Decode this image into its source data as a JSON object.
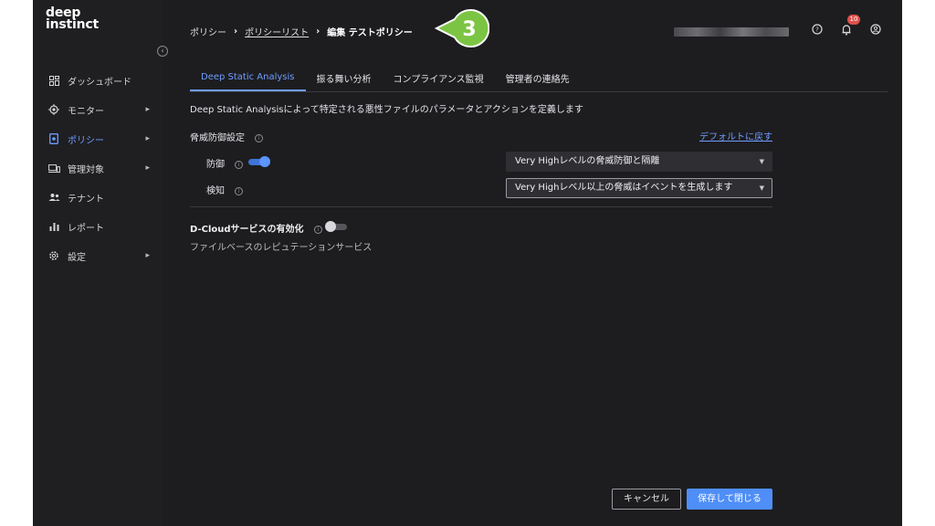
{
  "logo": {
    "line1": "deep",
    "line2": "instinct"
  },
  "sidebar": {
    "items": [
      {
        "label": "ダッシュボード",
        "icon": "dashboard-icon",
        "has_submenu": false,
        "active": false
      },
      {
        "label": "モニター",
        "icon": "monitor-icon",
        "has_submenu": true,
        "active": false
      },
      {
        "label": "ポリシー",
        "icon": "policy-icon",
        "has_submenu": true,
        "active": true
      },
      {
        "label": "管理対象",
        "icon": "devices-icon",
        "has_submenu": true,
        "active": false
      },
      {
        "label": "テナント",
        "icon": "tenant-icon",
        "has_submenu": false,
        "active": false
      },
      {
        "label": "レポート",
        "icon": "report-icon",
        "has_submenu": false,
        "active": false
      },
      {
        "label": "設定",
        "icon": "gear-icon",
        "has_submenu": true,
        "active": false
      }
    ]
  },
  "header": {
    "breadcrumb": {
      "root": "ポリシー",
      "list": "ポリシーリスト",
      "current": "編集 テストポリシー"
    },
    "step_marker": "3",
    "notification_count": "10"
  },
  "tabs": [
    {
      "label": "Deep Static Analysis",
      "active": true
    },
    {
      "label": "振る舞い分析",
      "active": false
    },
    {
      "label": "コンプライアンス監視",
      "active": false
    },
    {
      "label": "管理者の連絡先",
      "active": false
    }
  ],
  "content": {
    "description": "Deep Static Analysisによって特定される悪性ファイルのパラメータとアクションを定義します",
    "threat_section_title": "脅威防御設定",
    "reset_link": "デフォルトに戻す",
    "prevention": {
      "label": "防御",
      "enabled": true,
      "select_value": "Very Highレベルの脅威防御と隔離"
    },
    "detection": {
      "label": "検知",
      "select_value": "Very Highレベル以上の脅威はイベントを生成します"
    },
    "dcloud": {
      "label": "D-Cloudサービスの有効化",
      "enabled": false,
      "description": "ファイルベースのレピュテーションサービス"
    }
  },
  "footer": {
    "cancel_label": "キャンセル",
    "save_label": "保存して閉じる"
  },
  "colors": {
    "accent": "#4f8ef7",
    "step_marker": "#7cc443",
    "background": "#1d1d20"
  }
}
